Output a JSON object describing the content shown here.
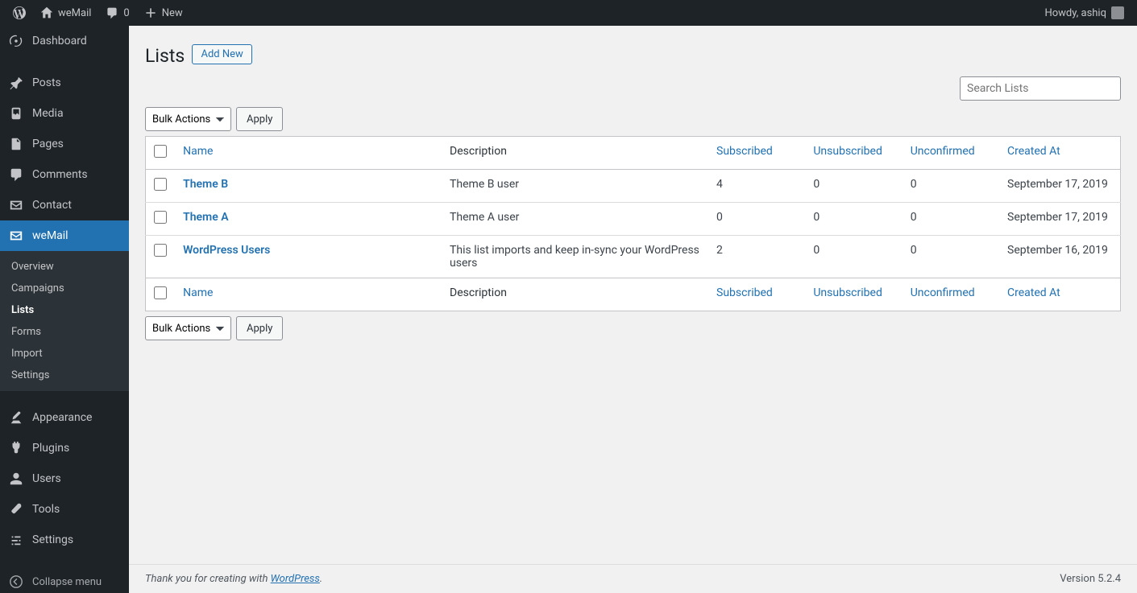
{
  "adminbar": {
    "site_name": "weMail",
    "comments_count": "0",
    "new_label": "New",
    "howdy": "Howdy, ashiq"
  },
  "sidebar": {
    "items": [
      {
        "label": "Dashboard"
      },
      {
        "label": "Posts"
      },
      {
        "label": "Media"
      },
      {
        "label": "Pages"
      },
      {
        "label": "Comments"
      },
      {
        "label": "Contact"
      },
      {
        "label": "weMail"
      },
      {
        "label": "Appearance"
      },
      {
        "label": "Plugins"
      },
      {
        "label": "Users"
      },
      {
        "label": "Tools"
      },
      {
        "label": "Settings"
      }
    ],
    "submenu": [
      {
        "label": "Overview"
      },
      {
        "label": "Campaigns"
      },
      {
        "label": "Lists"
      },
      {
        "label": "Forms"
      },
      {
        "label": "Import"
      },
      {
        "label": "Settings"
      }
    ],
    "collapse_label": "Collapse menu"
  },
  "page": {
    "title": "Lists",
    "add_new": "Add New",
    "search_placeholder": "Search Lists",
    "bulk_actions": "Bulk Actions",
    "apply": "Apply"
  },
  "columns": {
    "name": "Name",
    "description": "Description",
    "subscribed": "Subscribed",
    "unsubscribed": "Unsubscribed",
    "unconfirmed": "Unconfirmed",
    "created_at": "Created At"
  },
  "rows": [
    {
      "name": "Theme B",
      "description": "Theme B user",
      "subscribed": "4",
      "unsubscribed": "0",
      "unconfirmed": "0",
      "created_at": "September 17, 2019"
    },
    {
      "name": "Theme A",
      "description": "Theme A user",
      "subscribed": "0",
      "unsubscribed": "0",
      "unconfirmed": "0",
      "created_at": "September 17, 2019"
    },
    {
      "name": "WordPress Users",
      "description": "This list imports and keep in-sync your WordPress users",
      "subscribed": "2",
      "unsubscribed": "0",
      "unconfirmed": "0",
      "created_at": "September 16, 2019"
    }
  ],
  "footer": {
    "thanks_prefix": "Thank you for creating with ",
    "wp_link": "WordPress",
    "thanks_suffix": ".",
    "version": "Version 5.2.4"
  }
}
